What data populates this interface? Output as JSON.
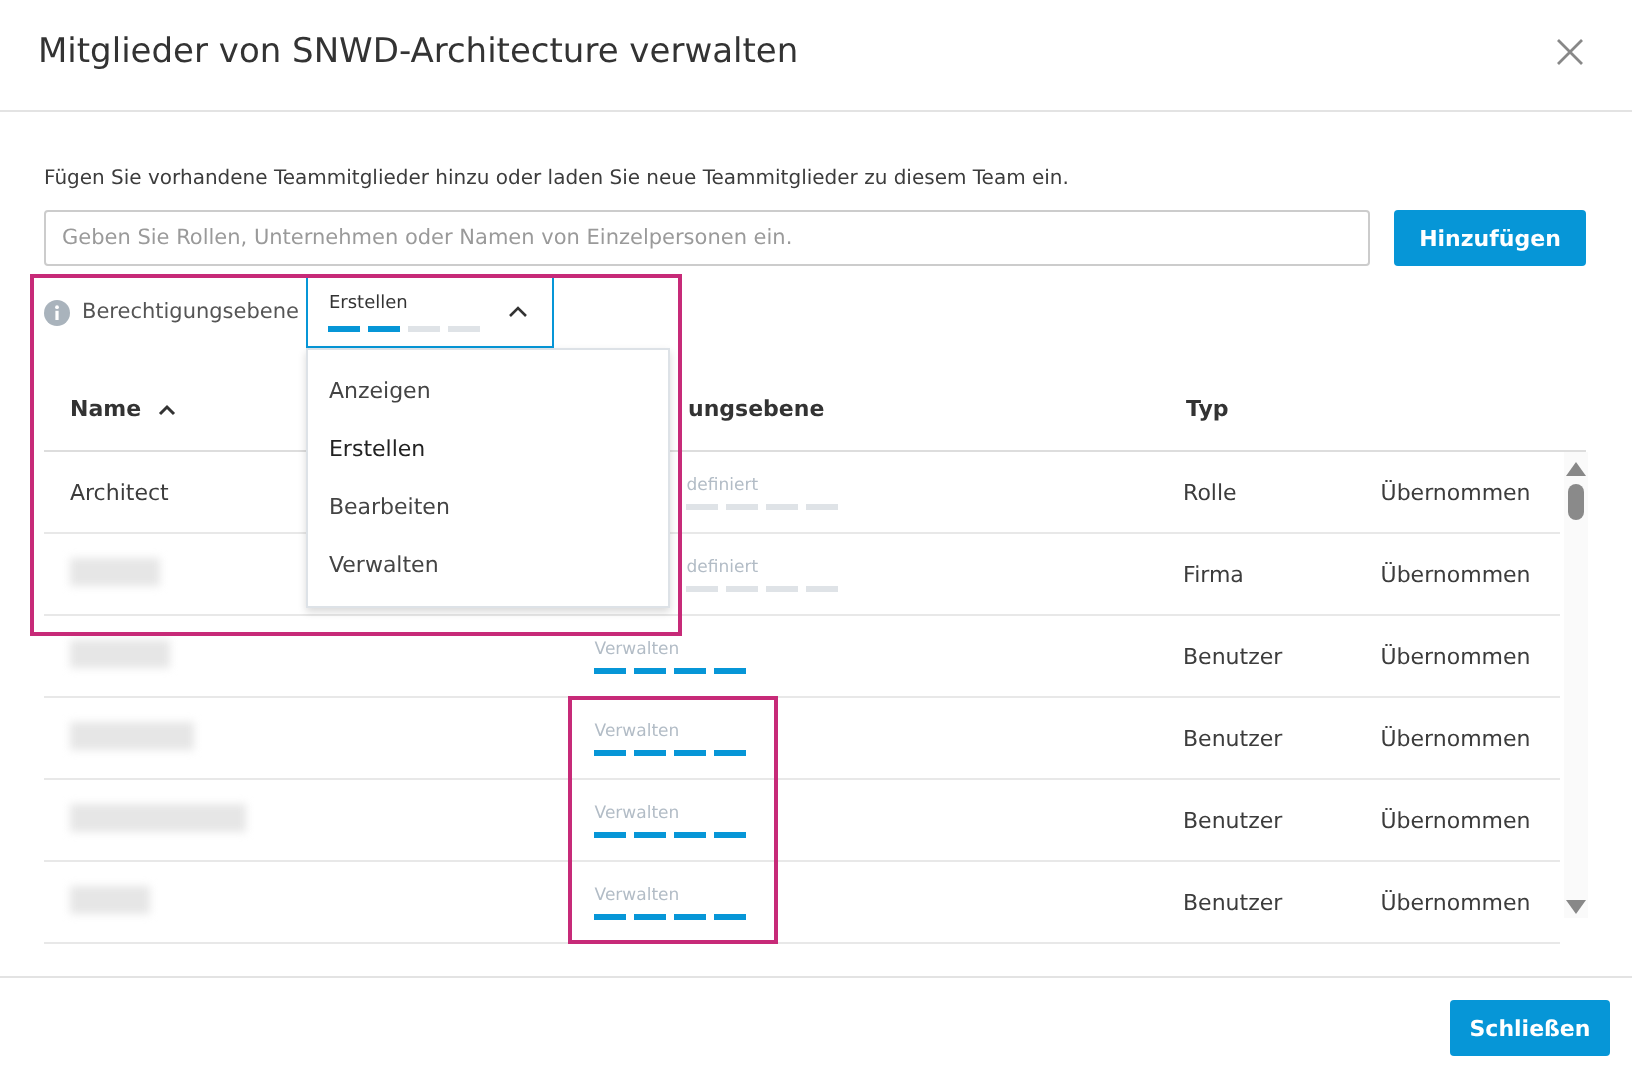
{
  "dialog": {
    "title": "Mitglieder von SNWD-Architecture verwalten",
    "description": "Fügen Sie vorhandene Teammitglieder hinzu oder laden Sie neue Teammitglieder zu diesem Team ein.",
    "search": {
      "placeholder": "Geben Sie Rollen, Unternehmen oder Namen von Einzelpersonen ein."
    },
    "add_button": "Hinzufügen",
    "permission": {
      "label": "Berechtigungsebene",
      "value": "Erstellen",
      "level": 0.5,
      "expanded": true,
      "options": [
        {
          "label": "Anzeigen",
          "selected": false
        },
        {
          "label": "Erstellen",
          "selected": true
        },
        {
          "label": "Bearbeiten",
          "selected": false
        },
        {
          "label": "Verwalten",
          "selected": false
        }
      ]
    },
    "table": {
      "columns": [
        {
          "label": "Name",
          "sorted": true
        },
        {
          "label": "ungsebene"
        },
        {
          "label": "Typ"
        }
      ],
      "rows": [
        {
          "name": "Architect",
          "redacted": false,
          "permission": "definiert",
          "type": "Rolle",
          "status": "Übernommen"
        },
        {
          "redacted": true,
          "permission": "definiert",
          "type": "Firma",
          "status": "Übernommen"
        },
        {
          "redacted": true,
          "permission": "Verwalten",
          "level": 1,
          "type": "Benutzer",
          "status": "Übernommen"
        },
        {
          "redacted": true,
          "permission": "Verwalten",
          "level": 1,
          "type": "Benutzer",
          "status": "Übernommen"
        },
        {
          "redacted": true,
          "permission": "Verwalten",
          "level": 1,
          "type": "Benutzer",
          "status": "Übernommen"
        },
        {
          "redacted": true,
          "permission": "Verwalten",
          "level": 1,
          "type": "Benutzer",
          "status": "Übernommen"
        }
      ]
    },
    "highlights": [
      {
        "color": "#c72a78"
      },
      {
        "color": "#c72a78"
      }
    ],
    "close_button": "Schließen"
  }
}
